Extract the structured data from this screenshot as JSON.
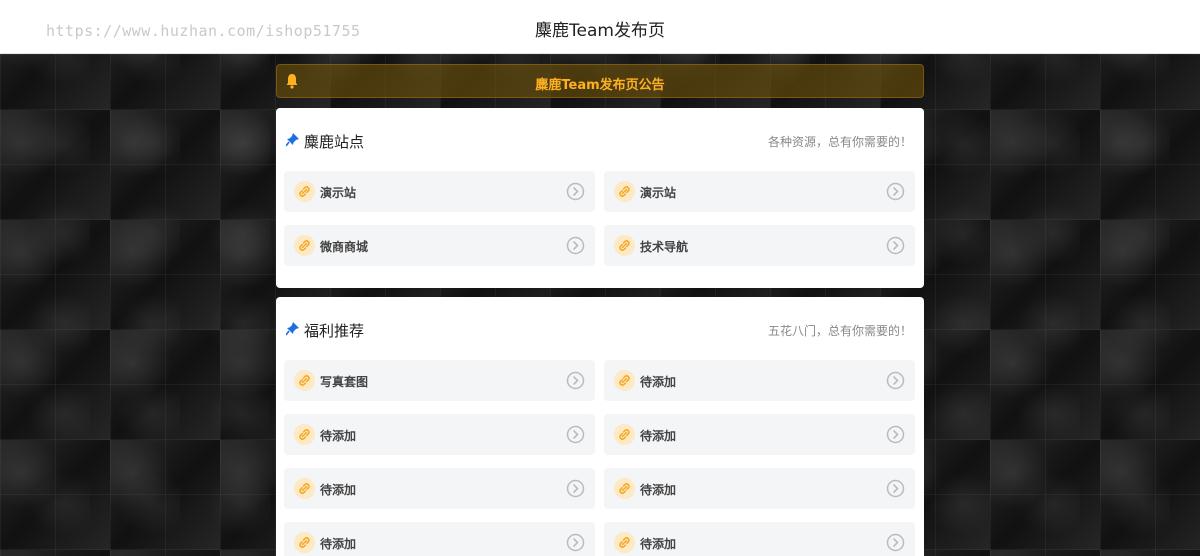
{
  "header": {
    "watermark": "https://www.huzhan.com/ishop51755",
    "title": "麋鹿Team发布页"
  },
  "notice": {
    "text": "麋鹿Team发布页公告"
  },
  "colors": {
    "accent": "#ffb020",
    "link_icon": "#f5a623",
    "pin_icon": "#1e6fe0"
  },
  "sections": [
    {
      "title": "麋鹿站点",
      "subtitle": "各种资源，总有你需要的！",
      "items": [
        {
          "label": "演示站"
        },
        {
          "label": "演示站"
        },
        {
          "label": "微商商城"
        },
        {
          "label": "技术导航"
        }
      ]
    },
    {
      "title": "福利推荐",
      "subtitle": "五花八门，总有你需要的！",
      "items": [
        {
          "label": "写真套图"
        },
        {
          "label": "待添加"
        },
        {
          "label": "待添加"
        },
        {
          "label": "待添加"
        },
        {
          "label": "待添加"
        },
        {
          "label": "待添加"
        },
        {
          "label": "待添加"
        },
        {
          "label": "待添加"
        }
      ]
    }
  ]
}
